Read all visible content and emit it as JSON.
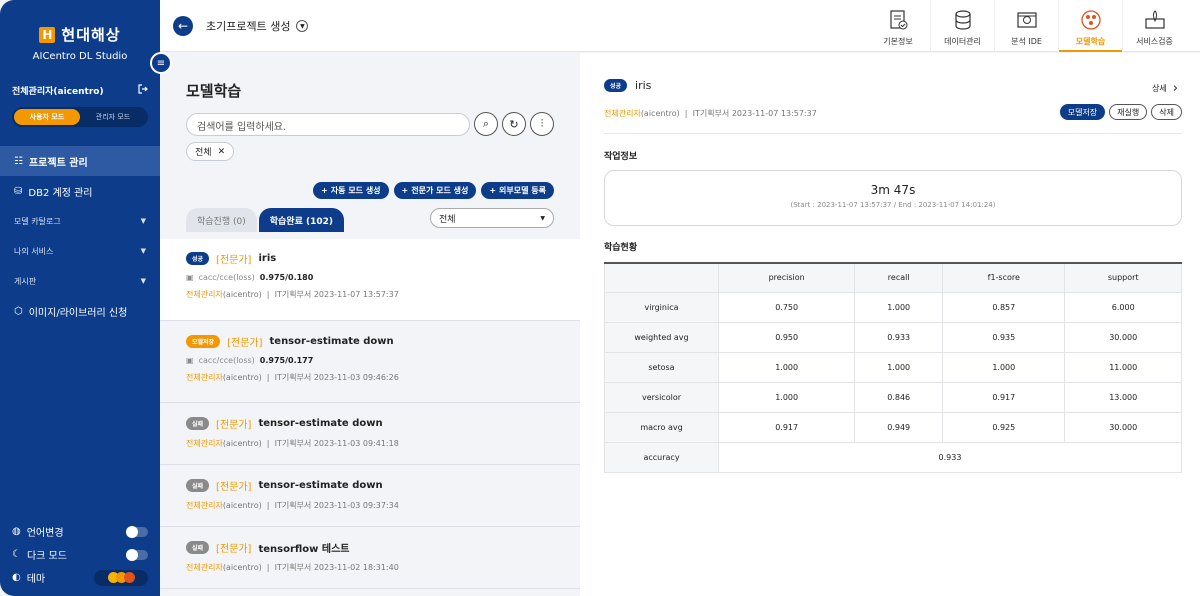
{
  "sidebar": {
    "logo_mark": "H",
    "brand": "현대해상",
    "subtitle": "AICentro DL Studio",
    "user": "전체관리자(aicentro)",
    "mode_user": "사용자 모드",
    "mode_admin": "관리자 모드",
    "nav": [
      {
        "label": "프로젝트 관리"
      },
      {
        "label": "DB2 계정 관리"
      },
      {
        "label": "모델 카탈로그"
      },
      {
        "label": "나의 서비스"
      },
      {
        "label": "게시판"
      },
      {
        "label": "이미지/라이브러리 신청"
      }
    ],
    "bottom": {
      "language": "언어변경",
      "dark": "다크 모드",
      "theme": "테마"
    },
    "theme_colors": [
      "#f5b400",
      "#f39800",
      "#e0531f"
    ]
  },
  "header": {
    "project": "초기프로젝트 생성",
    "nav": [
      {
        "label": "기본정보",
        "icon": "doc-check-icon"
      },
      {
        "label": "데이터관리",
        "icon": "database-icon"
      },
      {
        "label": "분석 IDE",
        "icon": "ide-icon"
      },
      {
        "label": "모델학습",
        "icon": "model-icon"
      },
      {
        "label": "서비스검증",
        "icon": "rocket-icon"
      }
    ]
  },
  "left": {
    "title": "모델학습",
    "search_placeholder": "검색어를 입력하세요.",
    "chip": "전체",
    "actions": [
      "자동 모드 생성",
      "전문가 모드 생성",
      "외부모델 등록"
    ],
    "tab_progress": "학습진행 (0)",
    "tab_done": "학습완료 (102)",
    "filter": "전체",
    "items": [
      {
        "badge": "성공",
        "badge_color": "#0d3d8a",
        "tag": "[전문가]",
        "name": "iris",
        "metric_label": "cacc/cce(loss)",
        "metric_value": "0.975/0.180",
        "owner": "전체관리자",
        "owner_id": "(aicentro)",
        "dept": "IT기획부서 2023-11-07 13:57:37"
      },
      {
        "badge": "모델저장",
        "badge_color": "#f39800",
        "tag": "[전문가]",
        "name": "tensor-estimate down",
        "metric_label": "cacc/cce(loss)",
        "metric_value": "0.975/0.177",
        "owner": "전체관리자",
        "owner_id": "(aicentro)",
        "dept": "IT기획부서 2023-11-03 09:46:26"
      },
      {
        "badge": "실패",
        "badge_color": "#8a8a8a",
        "tag": "[전문가]",
        "name": "tensor-estimate down",
        "owner": "전체관리자",
        "owner_id": "(aicentro)",
        "dept": "IT기획부서 2023-11-03 09:41:18"
      },
      {
        "badge": "실패",
        "badge_color": "#8a8a8a",
        "tag": "[전문가]",
        "name": "tensor-estimate down",
        "owner": "전체관리자",
        "owner_id": "(aicentro)",
        "dept": "IT기획부서 2023-11-03 09:37:34"
      },
      {
        "badge": "실패",
        "badge_color": "#8a8a8a",
        "tag": "[전문가]",
        "name": "tensorflow 테스트",
        "owner": "전체관리자",
        "owner_id": "(aicentro)",
        "dept": "IT기획부서 2023-11-02 18:31:40"
      }
    ]
  },
  "right": {
    "badge": "성공",
    "name": "iris",
    "detail": "상세",
    "owner": "전체관리자",
    "owner_id": "(aicentro)",
    "dept": "IT기획부서 2023-11-07 13:57:37",
    "btn_save": "모델저장",
    "btn_rerun": "재실행",
    "btn_delete": "삭제",
    "job_title": "작업정보",
    "duration": "3m 47s",
    "duration_sub": "(Start : 2023-11-07 13:57:37 / End : 2023-11-07 14:01:24)",
    "status_title": "학습현황",
    "columns": [
      "precision",
      "recall",
      "f1-score",
      "support"
    ],
    "rows": [
      {
        "label": "virginica",
        "values": [
          "0.750",
          "1.000",
          "0.857",
          "6.000"
        ]
      },
      {
        "label": "weighted avg",
        "values": [
          "0.950",
          "0.933",
          "0.935",
          "30.000"
        ]
      },
      {
        "label": "setosa",
        "values": [
          "1.000",
          "1.000",
          "1.000",
          "11.000"
        ]
      },
      {
        "label": "versicolor",
        "values": [
          "1.000",
          "0.846",
          "0.917",
          "13.000"
        ]
      },
      {
        "label": "macro avg",
        "values": [
          "0.917",
          "0.949",
          "0.925",
          "30.000"
        ]
      }
    ],
    "accuracy_label": "accuracy",
    "accuracy_value": "0.933"
  }
}
